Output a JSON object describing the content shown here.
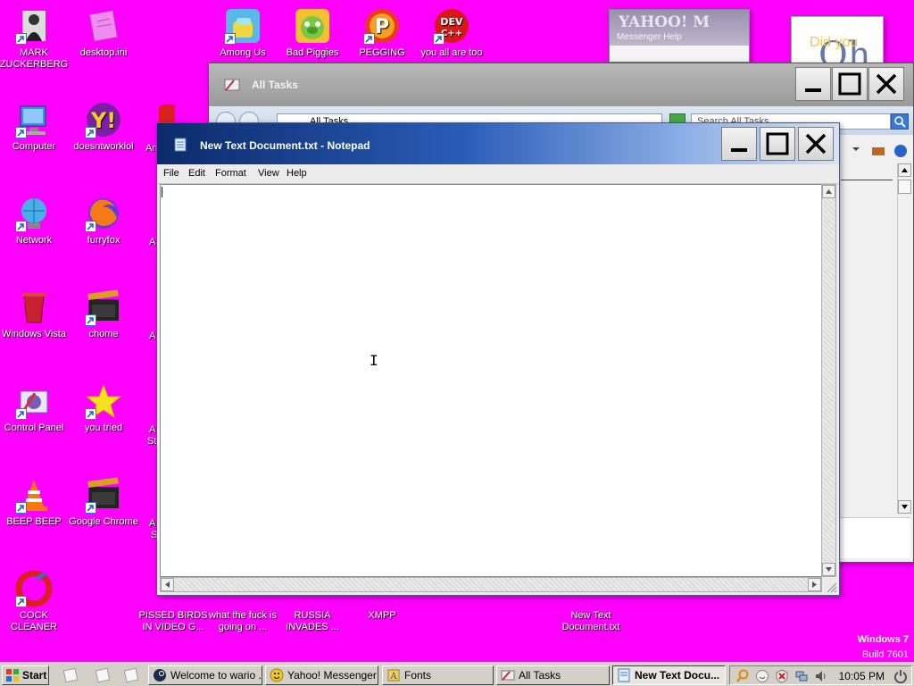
{
  "desktop": {
    "background": "#ff00ff",
    "icons": [
      {
        "label": "MARK ZUCKERBERG",
        "icon": "figure-icon"
      },
      {
        "label": "desktop.ini",
        "icon": "file-icon"
      },
      {
        "label": "Among Us",
        "icon": "among-us-icon"
      },
      {
        "label": "Bad Piggies",
        "icon": "bad-piggies-icon"
      },
      {
        "label": "PEGGING",
        "icon": "peggle-icon"
      },
      {
        "label": "you all are too",
        "icon": "devcpp-icon"
      },
      {
        "label": "Computer",
        "icon": "computer-icon"
      },
      {
        "label": "doesntworklol",
        "icon": "yahoo-icon"
      },
      {
        "label": "Network",
        "icon": "network-icon"
      },
      {
        "label": "furryfox",
        "icon": "firefox-icon"
      },
      {
        "label": "Windows Vista",
        "icon": "recycle-bin-icon"
      },
      {
        "label": "chome",
        "icon": "clapper-icon"
      },
      {
        "label": "Control Panel",
        "icon": "control-panel-icon"
      },
      {
        "label": "you tried",
        "icon": "star-icon"
      },
      {
        "label": "BEEP BEEP",
        "icon": "vlc-icon"
      },
      {
        "label": "Google Chrome",
        "icon": "clapper-icon"
      },
      {
        "label": "COCK CLEANER",
        "icon": "ccleaner-icon"
      },
      {
        "label": "PISSED BIRDS IN VIDEO G...",
        "icon": "angry-birds-icon"
      },
      {
        "label": "what the fuck is going on ...",
        "icon": "app-icon"
      },
      {
        "label": "RUSSIA INVADES ...",
        "icon": "app-icon"
      },
      {
        "label": "XMPP",
        "icon": "xmpp-icon"
      },
      {
        "label": "New Text Document.txt",
        "icon": "text-file-icon"
      }
    ],
    "partial_labels": [
      "An",
      "A",
      "A",
      "A",
      "A",
      "St",
      "A",
      "S"
    ]
  },
  "windows": {
    "yahoo": {
      "title": "YAHOO! M",
      "menu": "Messenger  Help"
    },
    "didyou": {
      "text": "Did you",
      "big": "Oh"
    },
    "all_tasks": {
      "title": "All Tasks",
      "address": "All Tasks",
      "search_placeholder": "Search All Tasks"
    },
    "notepad": {
      "title": "New Text Document.txt - Notepad",
      "menu": [
        "File",
        "Edit",
        "Format",
        "View",
        "Help"
      ],
      "content": ""
    }
  },
  "watermark": {
    "line1": "Windows 7",
    "line2": "Build 7601"
  },
  "taskbar": {
    "start_label": "Start",
    "buttons": [
      {
        "label": "Welcome to wario ...",
        "icon": "steam-icon",
        "active": false
      },
      {
        "label": "Yahoo! Messenger",
        "icon": "yahoo-icon",
        "active": false
      },
      {
        "label": "Fonts",
        "icon": "fonts-icon",
        "active": false
      },
      {
        "label": "All Tasks",
        "icon": "control-panel-icon",
        "active": false
      },
      {
        "label": "New Text Docu...",
        "icon": "notepad-icon",
        "active": true
      }
    ],
    "clock": "10:05 PM"
  },
  "colors": {
    "desktop": "#ff00ff",
    "notepad_title_start": "#0b2a6a",
    "notepad_title_end": "#d8e2f2",
    "taskbar": "#d4d0c8"
  }
}
